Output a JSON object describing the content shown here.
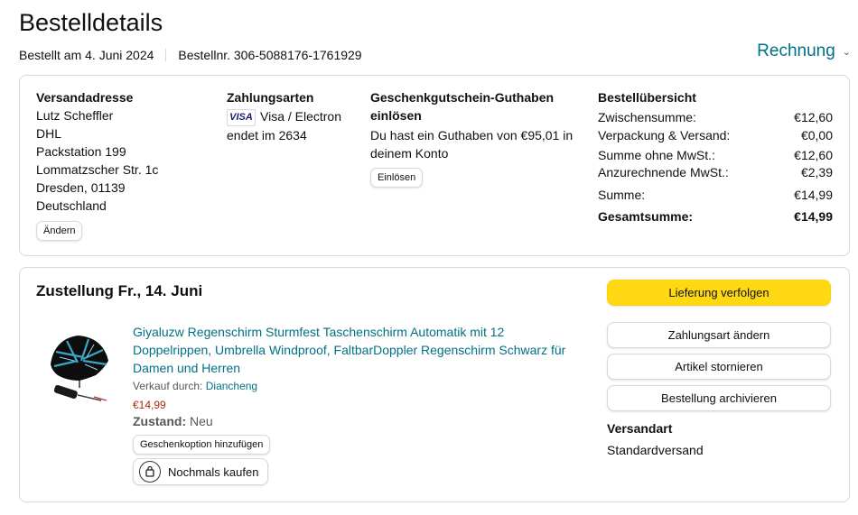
{
  "page": {
    "title": "Bestelldetails",
    "ordered": "Bestellt am 4. Juni 2024",
    "order_number": "Bestellnr. 306-5088176-1761929",
    "invoice_label": "Rechnung"
  },
  "address": {
    "heading": "Versandadresse",
    "lines": [
      "Lutz Scheffler",
      "DHL",
      "Packstation 199",
      "Lommatzscher Str. 1c",
      "Dresden, 01139",
      "Deutschland"
    ],
    "change_label": "Ändern"
  },
  "payment": {
    "heading": "Zahlungsarten",
    "card_logo": "VISA",
    "card_name": "Visa / Electron",
    "card_end": "endet im 2634"
  },
  "gift": {
    "heading": "Geschenkgutschein-Guthaben einlösen",
    "balance_text": "Du hast ein Guthaben von €95,01 in deinem Konto",
    "redeem_label": "Einlösen"
  },
  "summary": {
    "heading": "Bestellübersicht",
    "rows": [
      {
        "label": "Zwischensumme:",
        "value": "€12,60"
      },
      {
        "label": "Verpackung & Versand:",
        "value": "€0,00"
      },
      {
        "label": "Summe ohne MwSt.:",
        "value": "€12,60"
      },
      {
        "label": "Anzurechnende MwSt.:",
        "value": "€2,39"
      },
      {
        "label": "Summe:",
        "value": "€14,99"
      }
    ],
    "total_label": "Gesamtsumme:",
    "total_value": "€14,99"
  },
  "delivery": {
    "title": "Zustellung Fr., 14. Juni",
    "product_title": "Giyaluzw Regenschirm Sturmfest Taschenschirm Automatik mit 12 Doppelrippen, Umbrella Windproof, FaltbarDoppler Regenschirm Schwarz für Damen und Herren",
    "seller_label": "Verkauf durch:",
    "seller_name": "Diancheng",
    "price": "€14,99",
    "condition_label": "Zustand:",
    "condition_value": "Neu",
    "gift_option_label": "Geschenkoption hinzufügen",
    "buy_again_label": "Nochmals kaufen",
    "track_label": "Lieferung verfolgen",
    "change_payment_label": "Zahlungsart ändern",
    "cancel_label": "Artikel stornieren",
    "archive_label": "Bestellung archivieren",
    "shipping_heading": "Versandart",
    "shipping_value": "Standardversand"
  },
  "colors": {
    "link": "#007185",
    "price": "#b12704",
    "primary_button": "#ffd814"
  }
}
